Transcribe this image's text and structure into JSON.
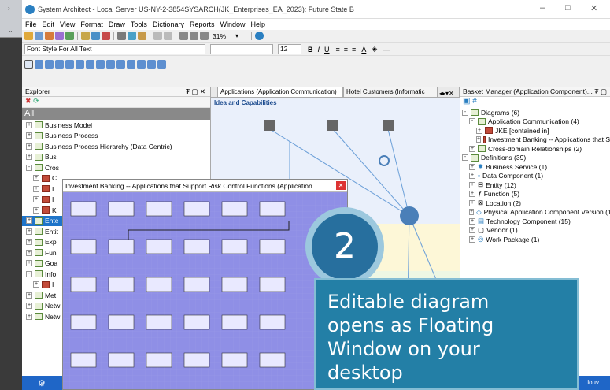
{
  "window": {
    "title": "System Architect - Local Server US-NY-2-3854SYSARCH(JK_Enterprises_EA_2023): Future State B",
    "controls": [
      "–",
      "□",
      "✕"
    ]
  },
  "menu": [
    "File",
    "Edit",
    "View",
    "Format",
    "Draw",
    "Tools",
    "Dictionary",
    "Reports",
    "Window",
    "Help"
  ],
  "toolbar": {
    "zoom": "31%",
    "font_style": "Font Style For All Text",
    "font_size": "12"
  },
  "explorer": {
    "title": "Explorer",
    "root": "All",
    "items": [
      {
        "label": "Business Model",
        "exp": "+"
      },
      {
        "label": "Business Process",
        "exp": "+"
      },
      {
        "label": "Business Process Hierarchy (Data Centric)",
        "exp": "+"
      },
      {
        "label": "Bus",
        "exp": "+"
      },
      {
        "label": "Cros",
        "exp": "-"
      },
      {
        "label": "C",
        "exp": "+"
      },
      {
        "label": "I",
        "exp": "+"
      },
      {
        "label": "I",
        "exp": "+"
      },
      {
        "label": "K",
        "exp": "+"
      },
      {
        "label": "Ente",
        "exp": "+"
      },
      {
        "label": "Entit",
        "exp": "+"
      },
      {
        "label": "Exp",
        "exp": "+"
      },
      {
        "label": "Fun",
        "exp": "+"
      },
      {
        "label": "Goa",
        "exp": "+"
      },
      {
        "label": "Info",
        "exp": "-"
      },
      {
        "label": "I",
        "exp": "+"
      },
      {
        "label": "Met",
        "exp": "+"
      },
      {
        "label": "Netw",
        "exp": "+"
      },
      {
        "label": "Netw",
        "exp": "+"
      }
    ]
  },
  "center": {
    "tabs": [
      "Applications (Application Communication)",
      "Hotel Customers (Informatic"
    ],
    "diagram_title": "Idea and Capabilities"
  },
  "basket": {
    "title": "Basket Manager (Application Component)...",
    "items": [
      {
        "label": "Diagrams (6)",
        "level": 0
      },
      {
        "label": "Application Communication (4)",
        "level": 1
      },
      {
        "label": "JKE [contained in]",
        "level": 2
      },
      {
        "label": "Investment Banking -- Applications that S",
        "level": 2
      },
      {
        "label": "Cross-domain Relationships (2)",
        "level": 1
      },
      {
        "label": "Definitions (39)",
        "level": 0
      },
      {
        "label": "Business Service (1)",
        "level": 1
      },
      {
        "label": "Data Component (1)",
        "level": 1
      },
      {
        "label": "Entity (12)",
        "level": 1
      },
      {
        "label": "Function (5)",
        "level": 1
      },
      {
        "label": "Location (2)",
        "level": 1
      },
      {
        "label": "Physical Application Component Version (1)",
        "level": 1
      },
      {
        "label": "Technology Component (15)",
        "level": 1
      },
      {
        "label": "Vendor (1)",
        "level": 1
      },
      {
        "label": "Work Package (1)",
        "level": 1
      }
    ]
  },
  "floating": {
    "title": "Investment Banking -- Applications that Support Risk Control Functions (Application ..."
  },
  "status": {
    "user": "louv"
  },
  "callout": {
    "step": "2",
    "text_lines": [
      "Editable diagram",
      "opens as Floating",
      "Window on your",
      "desktop"
    ]
  }
}
